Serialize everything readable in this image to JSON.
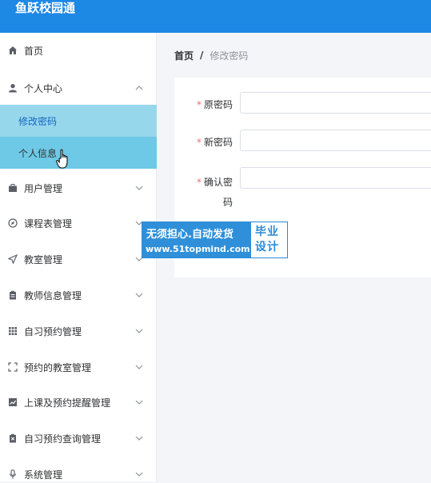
{
  "app": {
    "title": "鱼跃校园通"
  },
  "sidebar": {
    "home": {
      "label": "首页",
      "icon": "home-icon"
    },
    "personal_center": {
      "label": "个人中心",
      "icon": "user-icon",
      "expanded": true
    },
    "sub_items": [
      {
        "label": "修改密码",
        "state": "active"
      },
      {
        "label": "个人信息",
        "state": "hover"
      }
    ],
    "items": [
      {
        "label": "用户管理",
        "icon": "briefcase-icon"
      },
      {
        "label": "课程表管理",
        "icon": "compass-icon"
      },
      {
        "label": "教室管理",
        "icon": "send-icon"
      },
      {
        "label": "教师信息管理",
        "icon": "clipboard-icon"
      },
      {
        "label": "自习预约管理",
        "icon": "grid-icon"
      },
      {
        "label": "预约的教室管理",
        "icon": "frame-icon"
      },
      {
        "label": "上课及预约提醒管理",
        "icon": "chart-icon"
      },
      {
        "label": "自习预约查询管理",
        "icon": "clipboard-x-icon"
      },
      {
        "label": "系统管理",
        "icon": "microphone-icon"
      }
    ]
  },
  "breadcrumb": {
    "home": "首页",
    "separator": "/",
    "current": "修改密码"
  },
  "form": {
    "required_mark": "*",
    "old_password": {
      "label": "原密码",
      "value": ""
    },
    "new_password": {
      "label": "新密码",
      "value": ""
    },
    "confirm_password": {
      "label_line1": "确认密",
      "label_line2": "码",
      "value": ""
    }
  },
  "watermark": {
    "line1": "无须担心.自动发货",
    "line2": "www.51topmind.com",
    "side_line1": "毕业",
    "side_line2": "设计"
  },
  "colors": {
    "header": "#1e88e5",
    "active_submenu": "#97d7ec",
    "hover_submenu": "#6ec9e6",
    "required": "#f56c6c"
  }
}
